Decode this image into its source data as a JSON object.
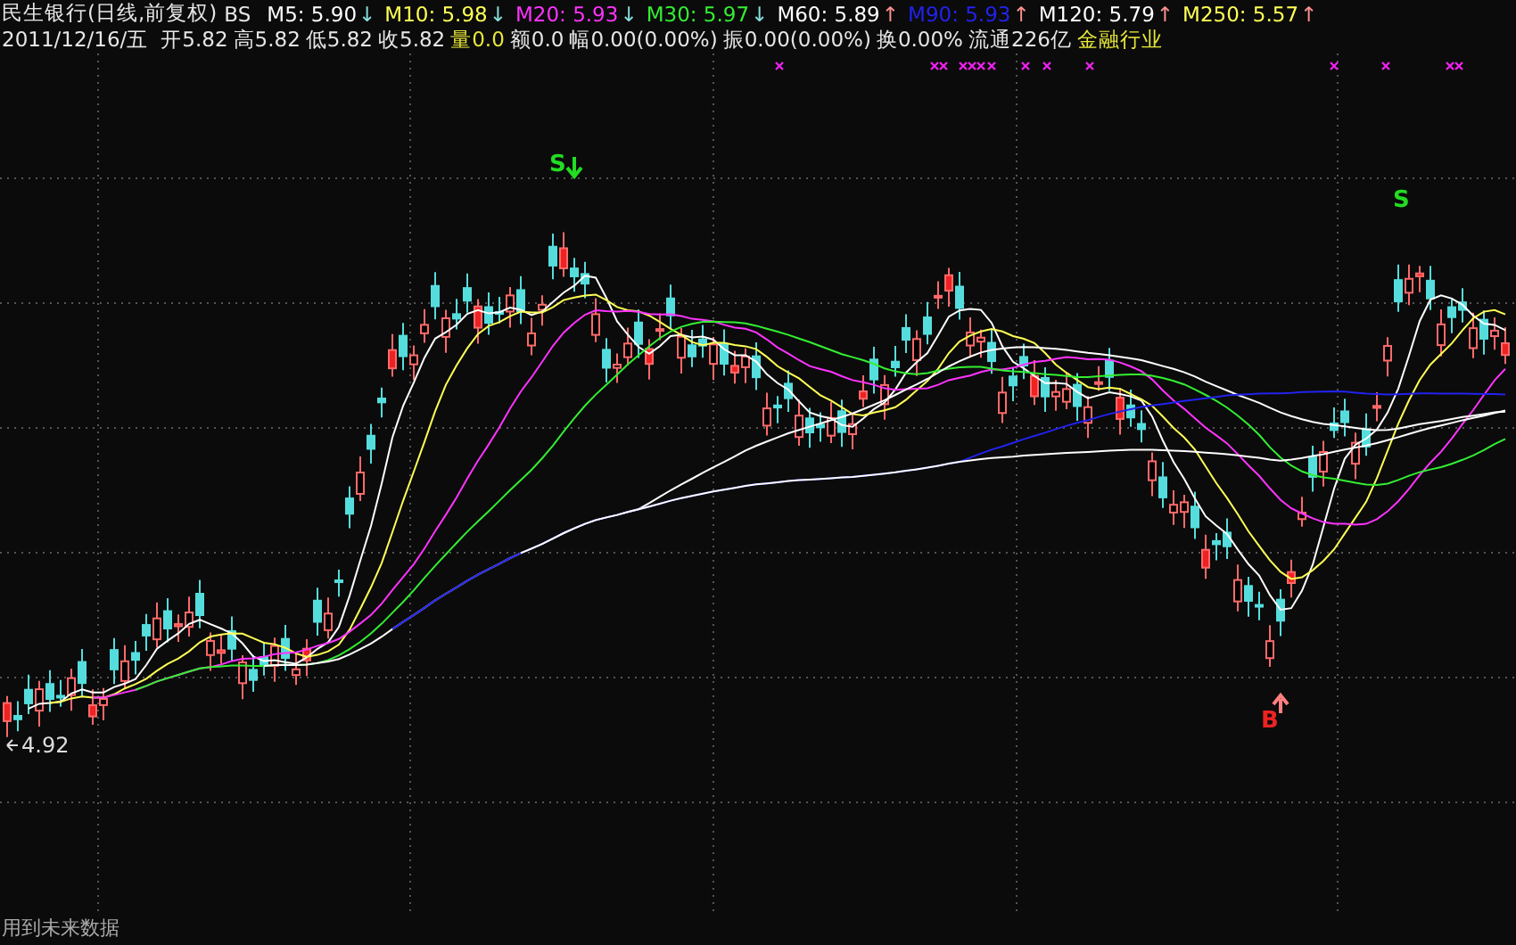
{
  "header": {
    "title": "民生银行(日线,前复权)",
    "indicator": "BS",
    "mas": [
      {
        "label": "M5:",
        "value": "5.90",
        "color": "#ffffff",
        "arrow": "↓",
        "rising": false
      },
      {
        "label": "M10:",
        "value": "5.98",
        "color": "#ffff55",
        "arrow": "↓",
        "rising": false
      },
      {
        "label": "M20:",
        "value": "5.93",
        "color": "#ff33ff",
        "arrow": "↓",
        "rising": false
      },
      {
        "label": "M30:",
        "value": "5.97",
        "color": "#33ee33",
        "arrow": "↓",
        "rising": false
      },
      {
        "label": "M60:",
        "value": "5.89",
        "color": "#ffffff",
        "arrow": "↑",
        "rising": true
      },
      {
        "label": "M90:",
        "value": "5.93",
        "color": "#2222ee",
        "arrow": "↑",
        "rising": true
      },
      {
        "label": "M120:",
        "value": "5.79",
        "color": "#ffffff",
        "arrow": "↑",
        "rising": true
      },
      {
        "label": "M250:",
        "value": "5.57",
        "color": "#ffff55",
        "arrow": "↑",
        "rising": true
      }
    ],
    "date": "2011/12/16/五",
    "stats": [
      {
        "label": "开",
        "value": "5.82",
        "highlight": false
      },
      {
        "label": "高",
        "value": "5.82",
        "highlight": false
      },
      {
        "label": "低",
        "value": "5.82",
        "highlight": false
      },
      {
        "label": "收",
        "value": "5.82",
        "highlight": false
      },
      {
        "label": "量",
        "value": "0.0",
        "highlight": true
      },
      {
        "label": "额",
        "value": "0.0",
        "highlight": false
      },
      {
        "label": "幅",
        "value": "0.00(0.00%)",
        "highlight": false
      },
      {
        "label": "振",
        "value": "0.00(0.00%)",
        "highlight": false
      },
      {
        "label": "换",
        "value": "0.00%",
        "highlight": false
      },
      {
        "label": "流通",
        "value": "226亿",
        "highlight": false
      }
    ],
    "sector": "金融行业"
  },
  "chart": {
    "signals": [
      {
        "text": "S",
        "kind": "sell"
      },
      {
        "text": "S",
        "kind": "sell"
      },
      {
        "text": "B",
        "kind": "buy"
      }
    ],
    "low_label": "4.92"
  },
  "footer": "用到未来数据"
}
